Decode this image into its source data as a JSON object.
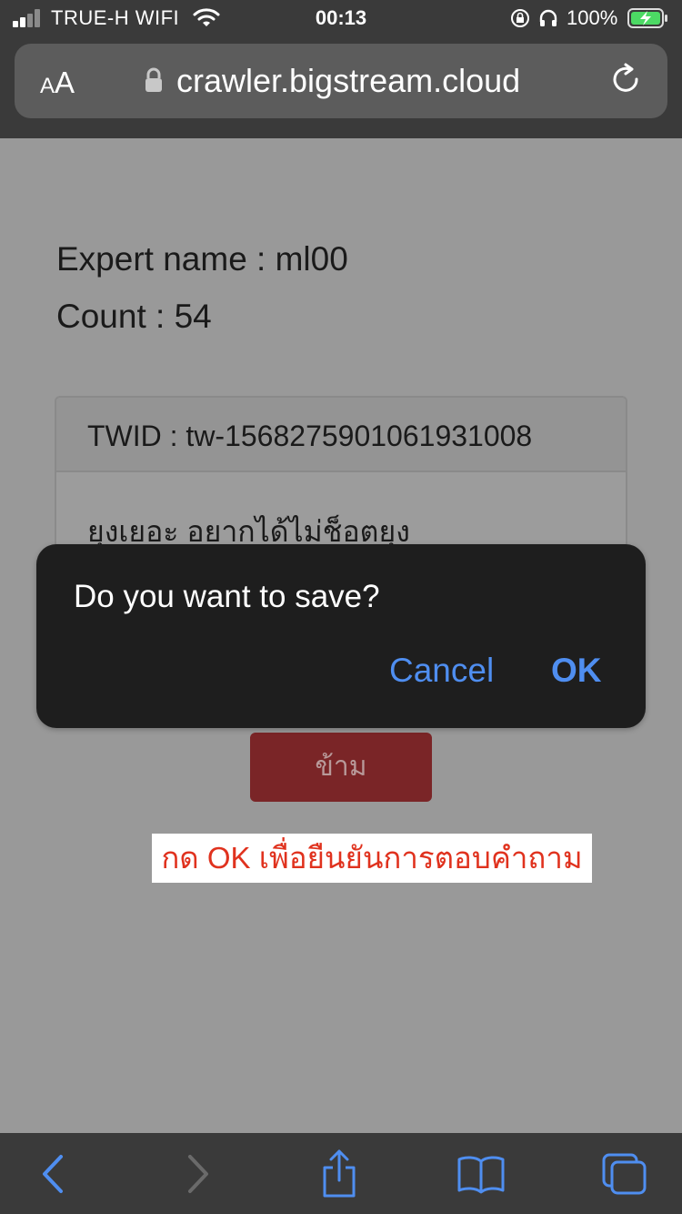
{
  "status_bar": {
    "carrier": "TRUE-H WIFI",
    "time": "00:13",
    "battery_percent": "100%",
    "icons": [
      "signal-icon",
      "wifi-icon",
      "rotation-lock-icon",
      "headphones-icon",
      "battery-charging-icon"
    ]
  },
  "address_bar": {
    "text_size_small": "A",
    "text_size_big": "A",
    "url": "crawler.bigstream.cloud",
    "icons": [
      "padlock-icon",
      "reload-icon"
    ]
  },
  "page": {
    "expert_label": "Expert name : ml00",
    "count_label": "Count : 54",
    "card": {
      "twid": "TWID : tw-1568275901061931008",
      "text": "ยุงเยอะ อยากได้ไม่ช็อตยุง"
    },
    "skip_button": "ข้าม",
    "instruction": "กด OK เพื่อยืนยันการตอบคำถาม"
  },
  "dialog": {
    "message": "Do you want to save?",
    "cancel": "Cancel",
    "ok": "OK"
  },
  "toolbar": {
    "icons": [
      "back-icon",
      "forward-icon",
      "share-icon",
      "bookmarks-icon",
      "tabs-icon"
    ]
  },
  "colors": {
    "accent": "#4f8ef0",
    "instruction_text": "#e0321e",
    "skip_button_bg": "#7a2527",
    "overlay_page_bg": "#999999"
  }
}
